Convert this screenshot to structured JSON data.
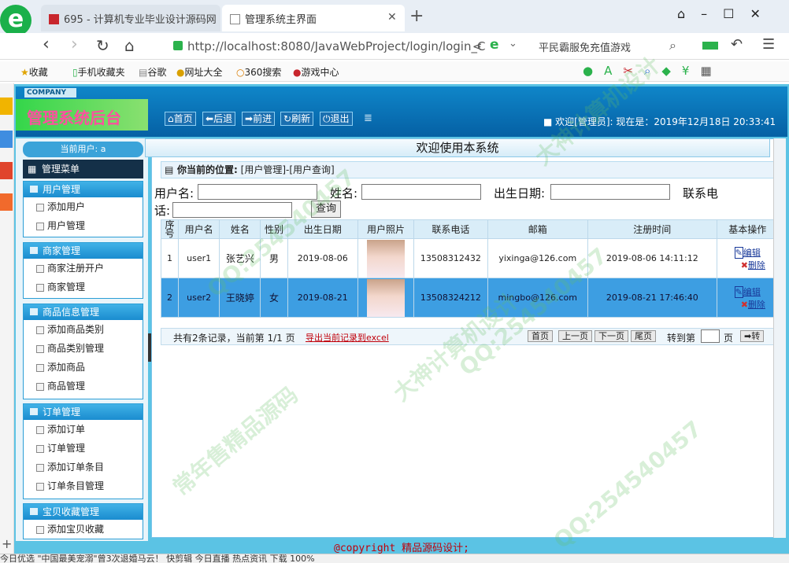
{
  "browser": {
    "tabs": [
      {
        "title": "695 - 计算机专业毕业设计源码网"
      },
      {
        "title": "管理系统主界面"
      }
    ],
    "new_tab": "+",
    "url": "http://localhost:8080/JavaWebProject/login/login_C",
    "search_hint": "平民霸服免充值游戏",
    "bookmarks": [
      "收藏",
      "手机收藏夹",
      "谷歌",
      "网址大全",
      "360搜索",
      "游戏中心"
    ]
  },
  "app": {
    "company": "COMPANY",
    "brand": "管理系统后台",
    "nav_buttons": [
      "首页",
      "后退",
      "前进",
      "刷新",
      "退出"
    ],
    "welcome": "欢迎[管理员]:   现在是：2019年12月18日 20:33:41",
    "page_title": "欢迎使用本系统",
    "footer": "@copyright 精品源码设计;"
  },
  "sidebar": {
    "current_user": "当前用户: a",
    "menu_title": "管理菜单",
    "groups": [
      {
        "title": "用户管理",
        "items": [
          "添加用户",
          "用户管理"
        ]
      },
      {
        "title": "商家管理",
        "items": [
          "商家注册开户",
          "商家管理"
        ]
      },
      {
        "title": "商品信息管理",
        "items": [
          "添加商品类别",
          "商品类别管理",
          "添加商品",
          "商品管理"
        ]
      },
      {
        "title": "订单管理",
        "items": [
          "添加订单",
          "订单管理",
          "添加订单条目",
          "订单条目管理"
        ]
      },
      {
        "title": "宝贝收藏管理",
        "items": [
          "添加宝贝收藏"
        ]
      }
    ]
  },
  "main": {
    "breadcrumb_label": "你当前的位置:",
    "breadcrumb_path": "[用户管理]-[用户查询]",
    "search": {
      "username_label": "用户名:",
      "name_label": "姓名:",
      "birth_label": "出生日期:",
      "phone_label_1": "联系电",
      "phone_label_2": "话:",
      "query_button": "查询"
    },
    "columns": [
      "序号",
      "用户名",
      "姓名",
      "性别",
      "出生日期",
      "用户照片",
      "联系电话",
      "邮箱",
      "注册时间",
      "基本操作"
    ],
    "rows": [
      {
        "no": "1",
        "username": "user1",
        "name": "张艺兴",
        "gender": "男",
        "birth": "2019-08-06",
        "phone": "13508312432",
        "email": "yixinga@126.com",
        "regtime": "2019-08-06 14:11:12",
        "edit": "编辑",
        "delete": "删除"
      },
      {
        "no": "2",
        "username": "user2",
        "name": "王晓婷",
        "gender": "女",
        "birth": "2019-08-21",
        "phone": "13508324212",
        "email": "mingbo@126.com",
        "regtime": "2019-08-21 17:46:40",
        "edit": "编辑",
        "delete": "删除"
      }
    ],
    "pager": {
      "summary": "共有2条记录，当前第 1/1 页",
      "export": "导出当前记录到excel",
      "first": "首页",
      "prev": "上一页",
      "next": "下一页",
      "last": "尾页",
      "goto_label": "转到第",
      "page_unit": "页",
      "go": "转"
    }
  },
  "watermarks": [
    "QQ:254540457",
    "常年售精品源码",
    "大神计算机设计"
  ],
  "taskbar": "今日优选   \"中国最美宠溺\"曾3次退婚马云！   快剪辑   今日直播   热点资讯   下载   100%"
}
